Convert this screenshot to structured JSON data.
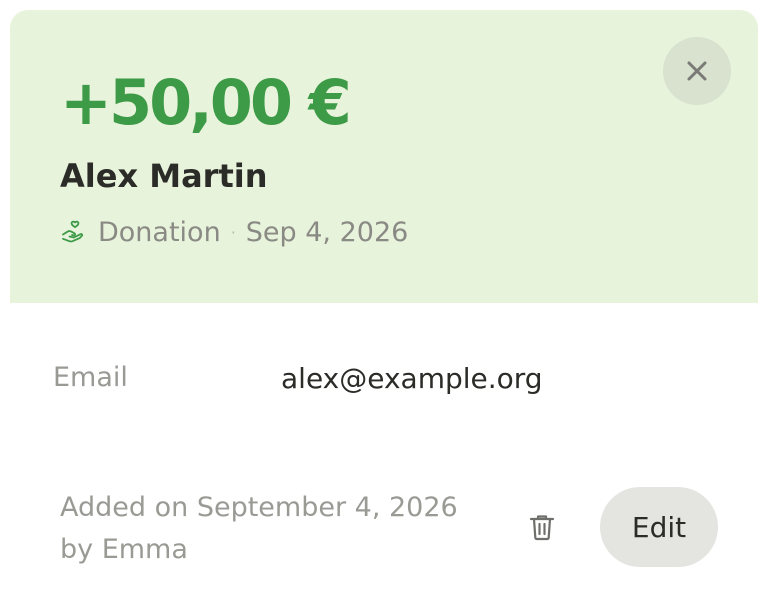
{
  "transaction": {
    "amount": "+50,00 €",
    "name": "Alex Martin",
    "category": "Donation",
    "separator": "·",
    "date": "Sep 4, 2026",
    "category_icon": "donation-hand-heart-icon"
  },
  "header": {
    "close_icon": "close-icon"
  },
  "details": {
    "email_label": "Email",
    "email_value": "alex@example.org"
  },
  "footer": {
    "added_line1": "Added on September 4, 2026",
    "added_line2": "by Emma",
    "delete_icon": "trash-icon",
    "edit_label": "Edit"
  },
  "colors": {
    "header_background": "#e8f3dc",
    "amount_green": "#3d9a46",
    "close_button_background": "#d8e2cf",
    "edit_button_background": "#e4e4e1"
  }
}
